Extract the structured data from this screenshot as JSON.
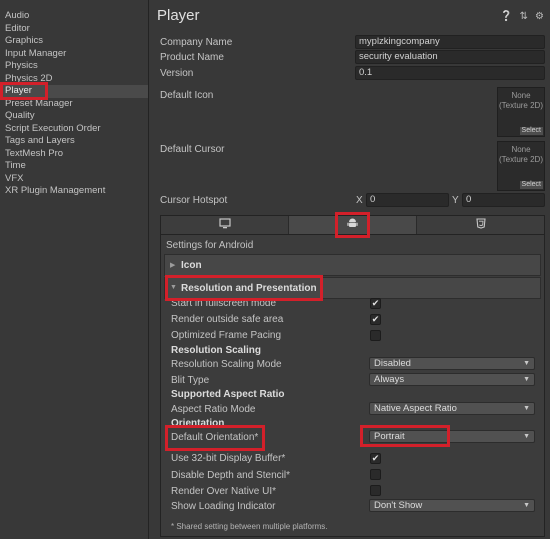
{
  "sidebar": {
    "items": [
      {
        "label": "Audio"
      },
      {
        "label": "Editor"
      },
      {
        "label": "Graphics"
      },
      {
        "label": "Input Manager"
      },
      {
        "label": "Physics"
      },
      {
        "label": "Physics 2D"
      },
      {
        "label": "Player",
        "selected": true
      },
      {
        "label": "Preset Manager"
      },
      {
        "label": "Quality"
      },
      {
        "label": "Script Execution Order"
      },
      {
        "label": "Tags and Layers"
      },
      {
        "label": "TextMesh Pro"
      },
      {
        "label": "Time"
      },
      {
        "label": "VFX"
      },
      {
        "label": "XR Plugin Management"
      }
    ]
  },
  "header": {
    "title": "Player",
    "icons": [
      "help-icon",
      "preset-icon",
      "settings-gear-icon"
    ]
  },
  "identity": {
    "company_label": "Company Name",
    "company_value": "myplzkingcompany",
    "product_label": "Product Name",
    "product_value": "security evaluation",
    "version_label": "Version",
    "version_value": "0.1"
  },
  "icon_section": {
    "default_icon_label": "Default Icon",
    "default_icon_none": "None",
    "default_icon_type": "(Texture 2D)",
    "select_label": "Select",
    "default_cursor_label": "Default Cursor",
    "default_cursor_none": "None",
    "default_cursor_type": "(Texture 2D)",
    "hotspot_label": "Cursor Hotspot",
    "hotspot_x_label": "X",
    "hotspot_x_value": "0",
    "hotspot_y_label": "Y",
    "hotspot_y_value": "0"
  },
  "platform_tabs": [
    "desktop-monitor-icon",
    "android-icon",
    "webgl-html5-icon"
  ],
  "active_platform_tab": 1,
  "settings": {
    "title": "Settings for Android",
    "icon_foldout": "Icon",
    "resolution_foldout": "Resolution and Presentation",
    "rows": {
      "fullscreen_label": "Start in fullscreen mode",
      "fullscreen_checked": true,
      "safe_area_label": "Render outside safe area",
      "safe_area_checked": true,
      "frame_pacing_label": "Optimized Frame Pacing",
      "frame_pacing_checked": false,
      "resolution_scaling_header": "Resolution Scaling",
      "scaling_mode_label": "Resolution Scaling Mode",
      "scaling_mode_value": "Disabled",
      "blit_label": "Blit Type",
      "blit_value": "Always",
      "aspect_header": "Supported Aspect Ratio",
      "aspect_mode_label": "Aspect Ratio Mode",
      "aspect_mode_value": "Native Aspect Ratio",
      "orientation_header": "Orientation",
      "default_orientation_label": "Default Orientation*",
      "default_orientation_value": "Portrait",
      "display_buffer_label": "Use 32-bit Display Buffer*",
      "display_buffer_checked": true,
      "depth_stencil_label": "Disable Depth and Stencil*",
      "depth_stencil_checked": false,
      "native_ui_label": "Render Over Native UI*",
      "native_ui_checked": false,
      "loading_indicator_label": "Show Loading Indicator",
      "loading_indicator_value": "Don't Show"
    },
    "footnote": "* Shared setting between multiple platforms."
  },
  "colors": {
    "highlight": "#d3202a",
    "background": "#383838",
    "panel": "#3c3c3c"
  }
}
